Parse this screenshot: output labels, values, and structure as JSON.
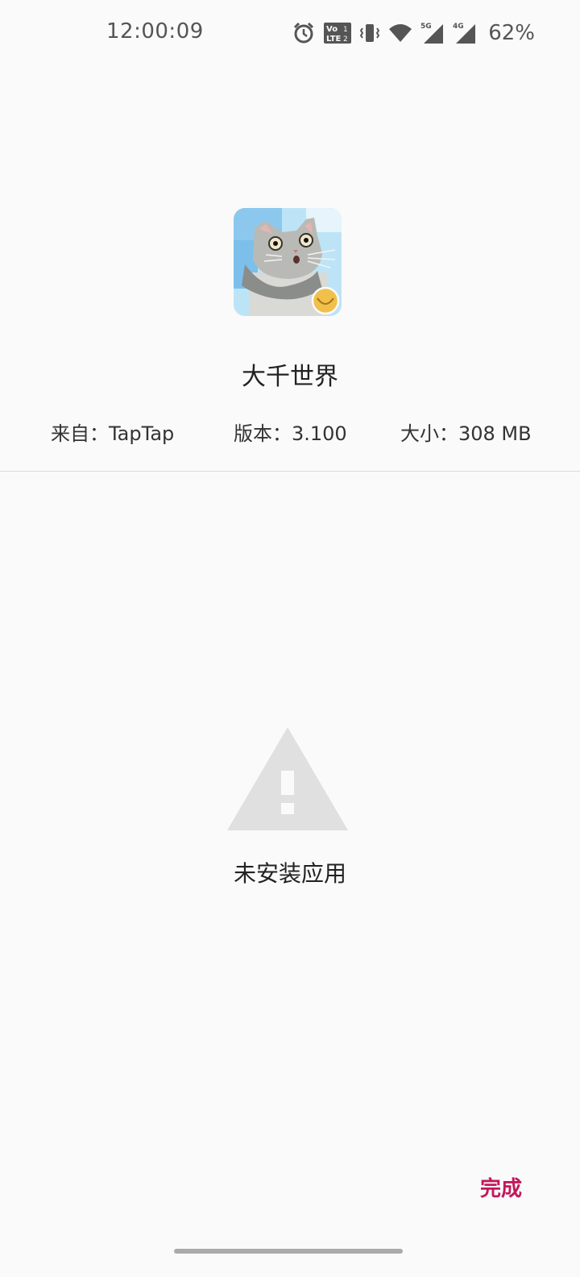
{
  "status_bar": {
    "time": "12:00:09",
    "battery": "62%",
    "icons": [
      "alarm-icon",
      "volte-icon",
      "vibrate-icon",
      "wifi-icon",
      "signal-5g-icon",
      "signal-4g-icon"
    ],
    "network_labels": [
      "5G",
      "4G"
    ]
  },
  "app": {
    "name": "大千世界",
    "icon": "app-cat-icon",
    "source": "来自：TapTap",
    "version": "版本：3.100",
    "size": "大小：308 MB"
  },
  "status": {
    "icon": "warning-icon",
    "message": "未安装应用"
  },
  "actions": {
    "done_label": "完成"
  },
  "colors": {
    "background": "#fafafa",
    "accent": "#c2185b",
    "warning_icon": "#e0e0e0",
    "divider": "#dcdcdc"
  }
}
